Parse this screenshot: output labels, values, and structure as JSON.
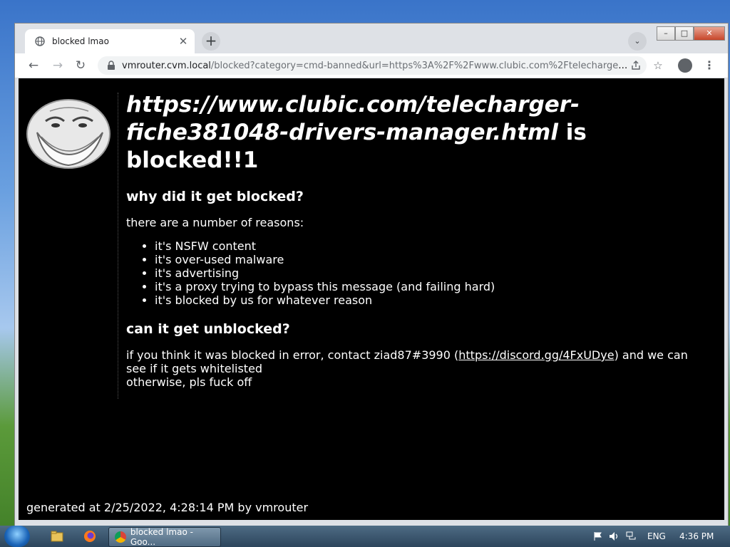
{
  "window": {
    "tab_title": "blocked lmao",
    "close_glyph": "✕",
    "newtab_glyph": "+",
    "tabsearch_glyph": "⌄",
    "controls": {
      "minimize": "–",
      "maximize": "□",
      "close": "✕"
    }
  },
  "toolbar": {
    "back_glyph": "←",
    "forward_glyph": "→",
    "reload_glyph": "↻",
    "url_host": "vmrouter.cvm.local",
    "url_path": "/blocked?category=cmd-banned&url=https%3A%2F%2Fwww.clubic.com%2Ftelecharger-fich...",
    "star_glyph": "☆",
    "menu_glyph": "⋮"
  },
  "page": {
    "blocked_url": "https://www.clubic.com/telecharger-fiche381048-drivers-manager.html",
    "heading_is": " is",
    "heading_blocked": "blocked!!1",
    "why_heading": "why did it get blocked?",
    "reasons_intro": "there are a number of reasons:",
    "reasons": [
      "it's NSFW content",
      "it's over-used malware",
      "it's advertising",
      "it's a proxy trying to bypass this message (and failing hard)",
      "it's blocked by us for whatever reason"
    ],
    "unblock_heading": "can it get unblocked?",
    "contact_text_1": "if you think it was blocked in error, contact ziad87#3990 (",
    "contact_link": "https://discord.gg/4FxUDye",
    "contact_text_2": ") and we can see if it gets whitelisted",
    "otherwise_text": "otherwise, pls fuck off",
    "footer": "generated at 2/25/2022, 4:28:14 PM by vmrouter"
  },
  "taskbar": {
    "task_label": "blocked lmao - Goo...",
    "language": "ENG",
    "clock": "4:36 PM"
  }
}
